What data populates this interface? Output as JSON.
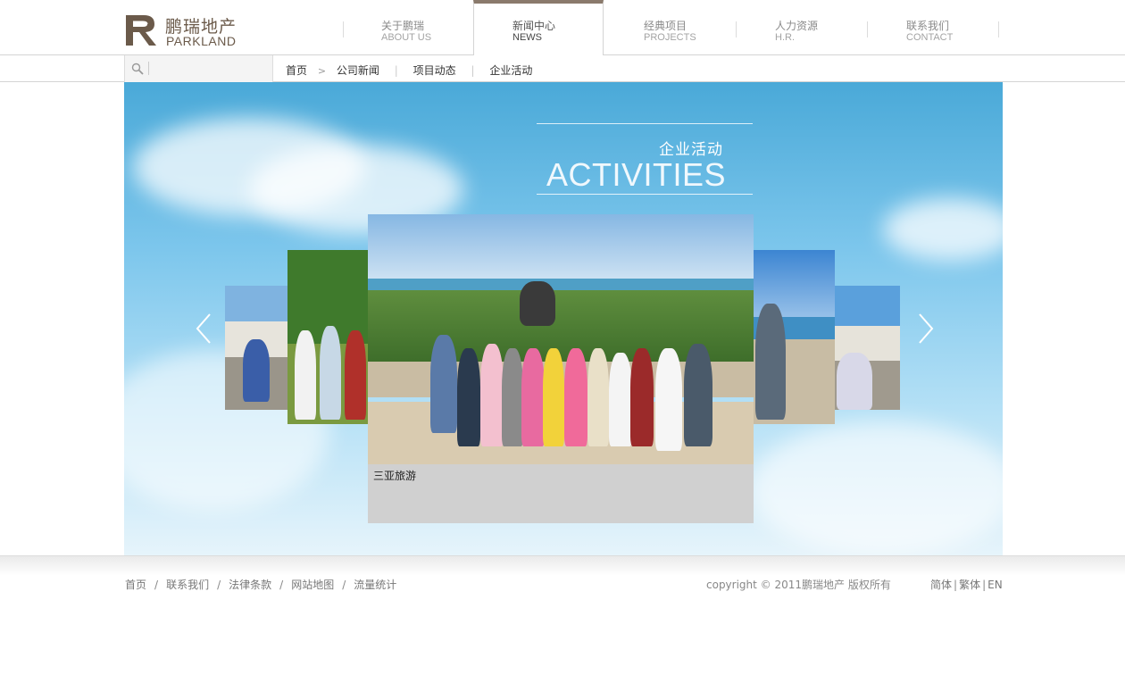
{
  "logo": {
    "cn": "鹏瑞地产",
    "en": "PARKLAND"
  },
  "nav": [
    {
      "cn": "关于鹏瑞",
      "en": "ABOUT US"
    },
    {
      "cn": "新闻中心",
      "en": "NEWS"
    },
    {
      "cn": "经典项目",
      "en": "PROJECTS"
    },
    {
      "cn": "人力资源",
      "en": "H.R."
    },
    {
      "cn": "联系我们",
      "en": "CONTACT"
    }
  ],
  "nav_active_index": 1,
  "search": {
    "placeholder": "",
    "value": ""
  },
  "breadcrumb": {
    "home": "首页",
    "arrow": ">",
    "items": [
      "公司新闻",
      "项目动态",
      "企业活动"
    ]
  },
  "banner": {
    "title_cn": "企业活动",
    "title_en": "ACTIVITIES",
    "caption": "三亚旅游"
  },
  "footer": {
    "links": [
      "首页",
      "联系我们",
      "法律条款",
      "网站地图",
      "流量统计"
    ],
    "separator": "/",
    "copyright": "copyright © 2011鹏瑞地产 版权所有",
    "languages": [
      "简体",
      "繁体",
      "EN"
    ]
  },
  "colors": {
    "brand": "#6b5a4a",
    "active_tab_border": "#8a7a6c",
    "caption_bg": "#d0d0d0"
  },
  "icons": {
    "search": "search-icon",
    "prev": "chevron-left-icon",
    "next": "chevron-right-icon"
  }
}
